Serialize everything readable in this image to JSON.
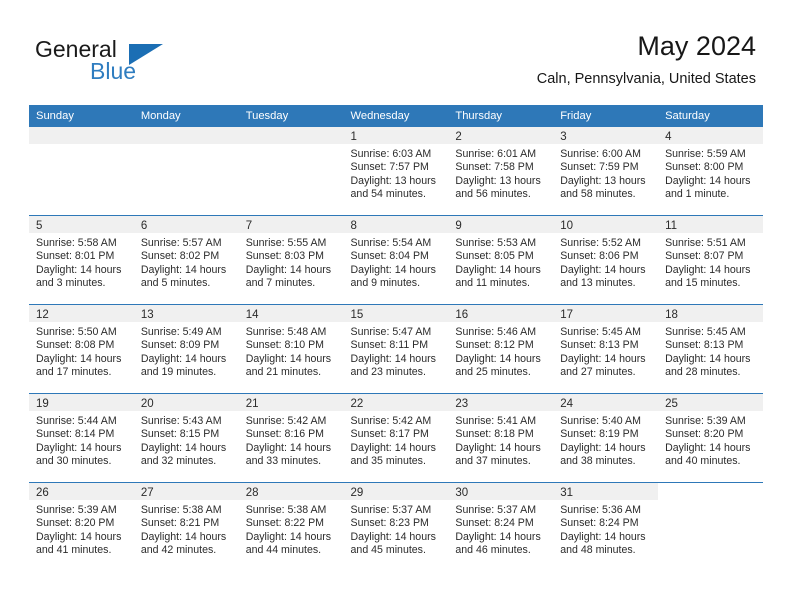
{
  "brand": {
    "name_part1": "General",
    "name_part2": "Blue",
    "triangle_color": "#1b6eb4",
    "accent_color": "#2f7dc0"
  },
  "header": {
    "title": "May 2024",
    "subtitle": "Caln, Pennsylvania, United States"
  },
  "theme": {
    "header_bg": "#2e78b8",
    "daynum_bg": "#f0f0f0",
    "grid_line": "#2e78b8",
    "text": "#2b2b2b"
  },
  "weekday_headers": [
    "Sunday",
    "Monday",
    "Tuesday",
    "Wednesday",
    "Thursday",
    "Friday",
    "Saturday"
  ],
  "weeks": [
    [
      {
        "day": "",
        "lines": []
      },
      {
        "day": "",
        "lines": []
      },
      {
        "day": "",
        "lines": []
      },
      {
        "day": "1",
        "lines": [
          "Sunrise: 6:03 AM",
          "Sunset: 7:57 PM",
          "Daylight: 13 hours",
          "and 54 minutes."
        ]
      },
      {
        "day": "2",
        "lines": [
          "Sunrise: 6:01 AM",
          "Sunset: 7:58 PM",
          "Daylight: 13 hours",
          "and 56 minutes."
        ]
      },
      {
        "day": "3",
        "lines": [
          "Sunrise: 6:00 AM",
          "Sunset: 7:59 PM",
          "Daylight: 13 hours",
          "and 58 minutes."
        ]
      },
      {
        "day": "4",
        "lines": [
          "Sunrise: 5:59 AM",
          "Sunset: 8:00 PM",
          "Daylight: 14 hours",
          "and 1 minute."
        ]
      }
    ],
    [
      {
        "day": "5",
        "lines": [
          "Sunrise: 5:58 AM",
          "Sunset: 8:01 PM",
          "Daylight: 14 hours",
          "and 3 minutes."
        ]
      },
      {
        "day": "6",
        "lines": [
          "Sunrise: 5:57 AM",
          "Sunset: 8:02 PM",
          "Daylight: 14 hours",
          "and 5 minutes."
        ]
      },
      {
        "day": "7",
        "lines": [
          "Sunrise: 5:55 AM",
          "Sunset: 8:03 PM",
          "Daylight: 14 hours",
          "and 7 minutes."
        ]
      },
      {
        "day": "8",
        "lines": [
          "Sunrise: 5:54 AM",
          "Sunset: 8:04 PM",
          "Daylight: 14 hours",
          "and 9 minutes."
        ]
      },
      {
        "day": "9",
        "lines": [
          "Sunrise: 5:53 AM",
          "Sunset: 8:05 PM",
          "Daylight: 14 hours",
          "and 11 minutes."
        ]
      },
      {
        "day": "10",
        "lines": [
          "Sunrise: 5:52 AM",
          "Sunset: 8:06 PM",
          "Daylight: 14 hours",
          "and 13 minutes."
        ]
      },
      {
        "day": "11",
        "lines": [
          "Sunrise: 5:51 AM",
          "Sunset: 8:07 PM",
          "Daylight: 14 hours",
          "and 15 minutes."
        ]
      }
    ],
    [
      {
        "day": "12",
        "lines": [
          "Sunrise: 5:50 AM",
          "Sunset: 8:08 PM",
          "Daylight: 14 hours",
          "and 17 minutes."
        ]
      },
      {
        "day": "13",
        "lines": [
          "Sunrise: 5:49 AM",
          "Sunset: 8:09 PM",
          "Daylight: 14 hours",
          "and 19 minutes."
        ]
      },
      {
        "day": "14",
        "lines": [
          "Sunrise: 5:48 AM",
          "Sunset: 8:10 PM",
          "Daylight: 14 hours",
          "and 21 minutes."
        ]
      },
      {
        "day": "15",
        "lines": [
          "Sunrise: 5:47 AM",
          "Sunset: 8:11 PM",
          "Daylight: 14 hours",
          "and 23 minutes."
        ]
      },
      {
        "day": "16",
        "lines": [
          "Sunrise: 5:46 AM",
          "Sunset: 8:12 PM",
          "Daylight: 14 hours",
          "and 25 minutes."
        ]
      },
      {
        "day": "17",
        "lines": [
          "Sunrise: 5:45 AM",
          "Sunset: 8:13 PM",
          "Daylight: 14 hours",
          "and 27 minutes."
        ]
      },
      {
        "day": "18",
        "lines": [
          "Sunrise: 5:45 AM",
          "Sunset: 8:13 PM",
          "Daylight: 14 hours",
          "and 28 minutes."
        ]
      }
    ],
    [
      {
        "day": "19",
        "lines": [
          "Sunrise: 5:44 AM",
          "Sunset: 8:14 PM",
          "Daylight: 14 hours",
          "and 30 minutes."
        ]
      },
      {
        "day": "20",
        "lines": [
          "Sunrise: 5:43 AM",
          "Sunset: 8:15 PM",
          "Daylight: 14 hours",
          "and 32 minutes."
        ]
      },
      {
        "day": "21",
        "lines": [
          "Sunrise: 5:42 AM",
          "Sunset: 8:16 PM",
          "Daylight: 14 hours",
          "and 33 minutes."
        ]
      },
      {
        "day": "22",
        "lines": [
          "Sunrise: 5:42 AM",
          "Sunset: 8:17 PM",
          "Daylight: 14 hours",
          "and 35 minutes."
        ]
      },
      {
        "day": "23",
        "lines": [
          "Sunrise: 5:41 AM",
          "Sunset: 8:18 PM",
          "Daylight: 14 hours",
          "and 37 minutes."
        ]
      },
      {
        "day": "24",
        "lines": [
          "Sunrise: 5:40 AM",
          "Sunset: 8:19 PM",
          "Daylight: 14 hours",
          "and 38 minutes."
        ]
      },
      {
        "day": "25",
        "lines": [
          "Sunrise: 5:39 AM",
          "Sunset: 8:20 PM",
          "Daylight: 14 hours",
          "and 40 minutes."
        ]
      }
    ],
    [
      {
        "day": "26",
        "lines": [
          "Sunrise: 5:39 AM",
          "Sunset: 8:20 PM",
          "Daylight: 14 hours",
          "and 41 minutes."
        ]
      },
      {
        "day": "27",
        "lines": [
          "Sunrise: 5:38 AM",
          "Sunset: 8:21 PM",
          "Daylight: 14 hours",
          "and 42 minutes."
        ]
      },
      {
        "day": "28",
        "lines": [
          "Sunrise: 5:38 AM",
          "Sunset: 8:22 PM",
          "Daylight: 14 hours",
          "and 44 minutes."
        ]
      },
      {
        "day": "29",
        "lines": [
          "Sunrise: 5:37 AM",
          "Sunset: 8:23 PM",
          "Daylight: 14 hours",
          "and 45 minutes."
        ]
      },
      {
        "day": "30",
        "lines": [
          "Sunrise: 5:37 AM",
          "Sunset: 8:24 PM",
          "Daylight: 14 hours",
          "and 46 minutes."
        ]
      },
      {
        "day": "31",
        "lines": [
          "Sunrise: 5:36 AM",
          "Sunset: 8:24 PM",
          "Daylight: 14 hours",
          "and 48 minutes."
        ]
      },
      {
        "day": "",
        "lines": [],
        "blank": true
      }
    ]
  ]
}
